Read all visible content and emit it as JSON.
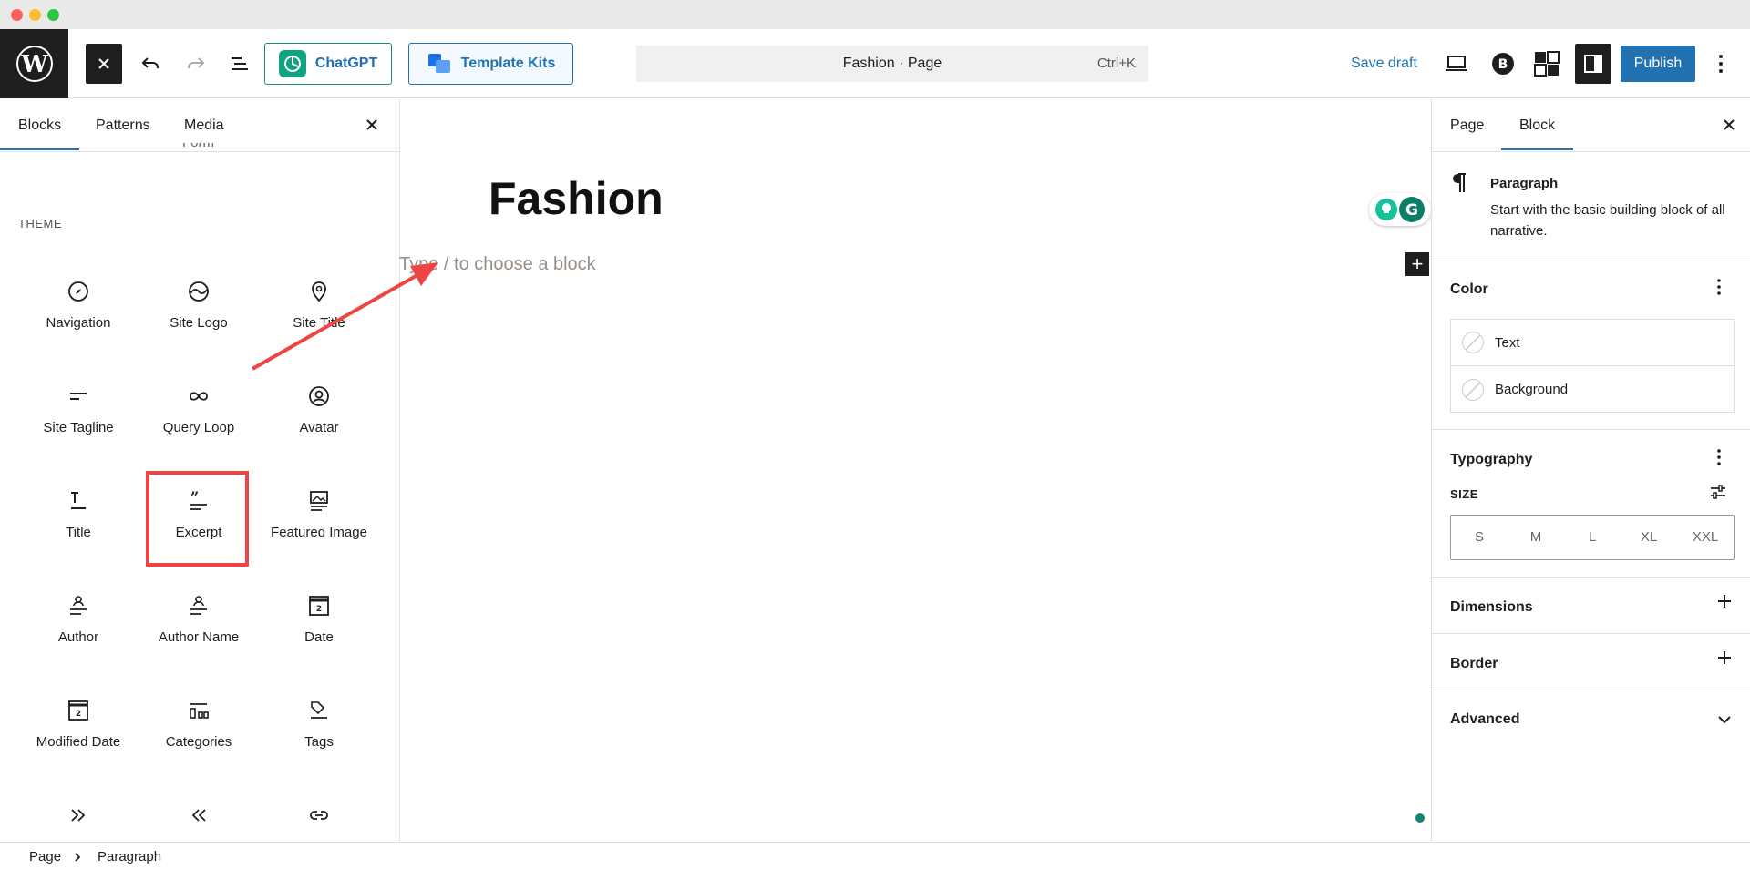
{
  "window": {
    "dots": [
      "#fe5f57",
      "#febc2e",
      "#28c840"
    ]
  },
  "toolbar": {
    "chatgpt_label": "ChatGPT",
    "template_kits_label": "Template Kits",
    "document_title": "Fashion · Page",
    "shortcut": "Ctrl+K",
    "save_draft_label": "Save draft",
    "publish_label": "Publish"
  },
  "inserter": {
    "tabs": [
      "Blocks",
      "Patterns",
      "Media"
    ],
    "partial_label": "Form",
    "section": "THEME",
    "blocks": [
      {
        "label": "Navigation",
        "icon": "compass-icon"
      },
      {
        "label": "Site Logo",
        "icon": "logo-icon"
      },
      {
        "label": "Site Title",
        "icon": "map-marker-icon"
      },
      {
        "label": "Site Tagline",
        "icon": "tagline-icon"
      },
      {
        "label": "Query Loop",
        "icon": "loop-icon"
      },
      {
        "label": "Avatar",
        "icon": "avatar-icon"
      },
      {
        "label": "Title",
        "icon": "title-icon"
      },
      {
        "label": "Excerpt",
        "icon": "excerpt-icon"
      },
      {
        "label": "Featured Image",
        "icon": "image-icon"
      },
      {
        "label": "Author",
        "icon": "author-icon"
      },
      {
        "label": "Author Name",
        "icon": "author-name-icon"
      },
      {
        "label": "Date",
        "icon": "calendar-icon"
      },
      {
        "label": "Modified Date",
        "icon": "calendar-icon"
      },
      {
        "label": "Categories",
        "icon": "categories-icon"
      },
      {
        "label": "Tags",
        "icon": "tag-icon"
      },
      {
        "label": "",
        "icon": "next-icon"
      },
      {
        "label": "",
        "icon": "previous-icon"
      },
      {
        "label": "",
        "icon": "link-icon"
      }
    ]
  },
  "canvas": {
    "title": "Fashion",
    "placeholder": "Type / to choose a block"
  },
  "sidebar": {
    "tabs": [
      "Page",
      "Block"
    ],
    "block_name": "Paragraph",
    "block_description": "Start with the basic building block of all narrative.",
    "color_title": "Color",
    "color_items": [
      "Text",
      "Background"
    ],
    "typography_title": "Typography",
    "size_label": "SIZE",
    "sizes": [
      "S",
      "M",
      "L",
      "XL",
      "XXL"
    ],
    "dimensions_title": "Dimensions",
    "border_title": "Border",
    "advanced_title": "Advanced"
  },
  "breadcrumb": [
    "Page",
    "Paragraph"
  ],
  "colors": {
    "accent": "#2271b1",
    "annotation": "#ef4444",
    "dark": "#1e1e1e"
  }
}
